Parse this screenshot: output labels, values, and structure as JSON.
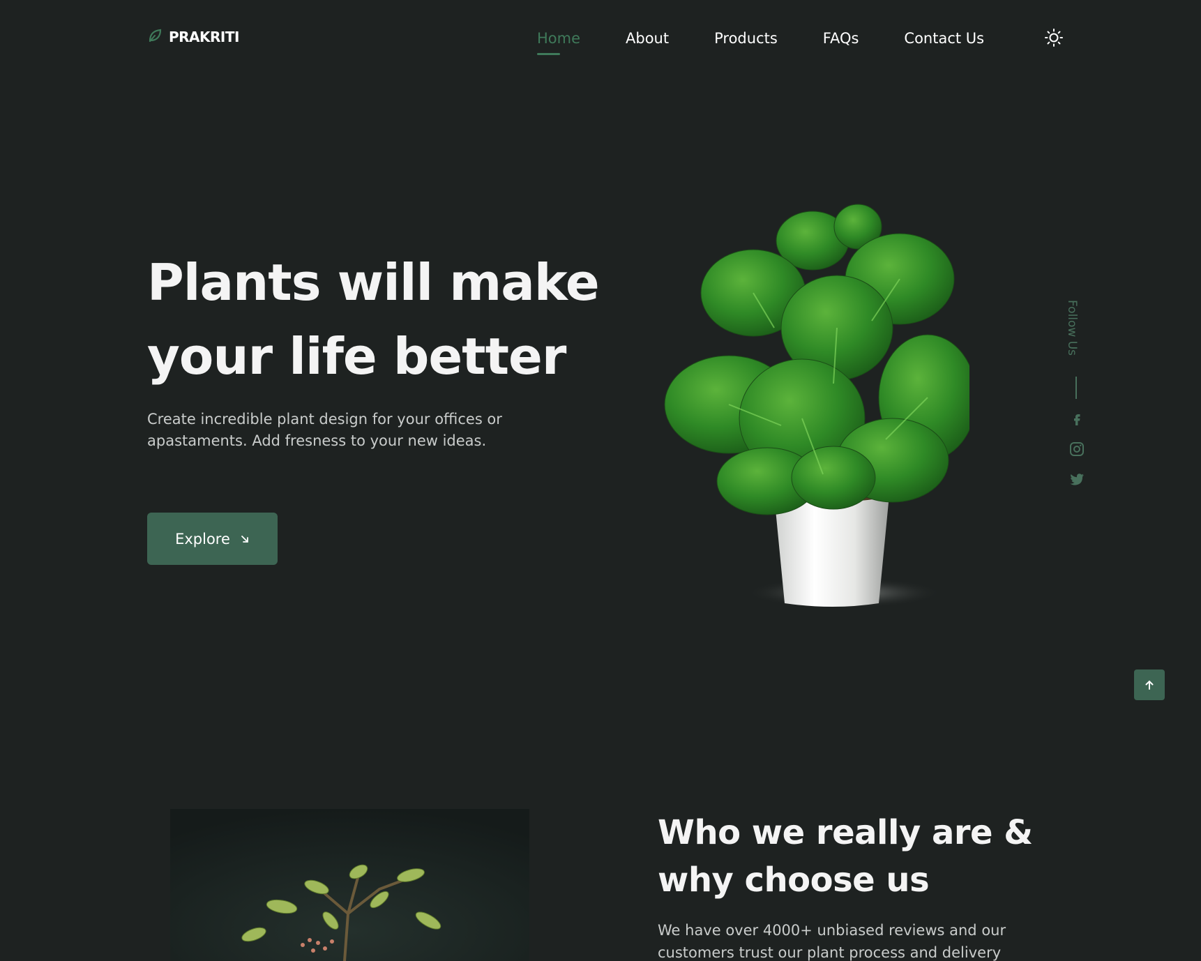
{
  "brand": {
    "name": "PRAKRITI",
    "icon": "leaf-icon"
  },
  "nav": {
    "items": [
      {
        "label": "Home",
        "active": true
      },
      {
        "label": "About",
        "active": false
      },
      {
        "label": "Products",
        "active": false
      },
      {
        "label": "FAQs",
        "active": false
      },
      {
        "label": "Contact Us",
        "active": false
      }
    ],
    "theme_toggle_icon": "sun-icon"
  },
  "hero": {
    "title_line1": "Plants will make",
    "title_line2": "your life better",
    "subtitle": "Create incredible plant design for your offices or apastaments. Add fresness to your new ideas.",
    "cta_label": "Explore",
    "cta_icon": "arrow-down-right-icon",
    "image": "potted-monstera-plant"
  },
  "follow": {
    "label": "Follow Us",
    "socials": [
      "facebook-icon",
      "instagram-icon",
      "twitter-icon"
    ]
  },
  "scroll_top_icon": "arrow-up-icon",
  "about": {
    "title_line1": "Who we really are &",
    "title_line2": "why choose us",
    "text": "We have over 4000+ unbiased reviews and our customers trust our plant process and delivery",
    "image": "small-tree-photo"
  },
  "colors": {
    "background": "#1e2221",
    "accent": "#3f7a5a",
    "button": "#3d6553",
    "text": "#f2f2f2",
    "muted_text": "#c9cccb"
  }
}
